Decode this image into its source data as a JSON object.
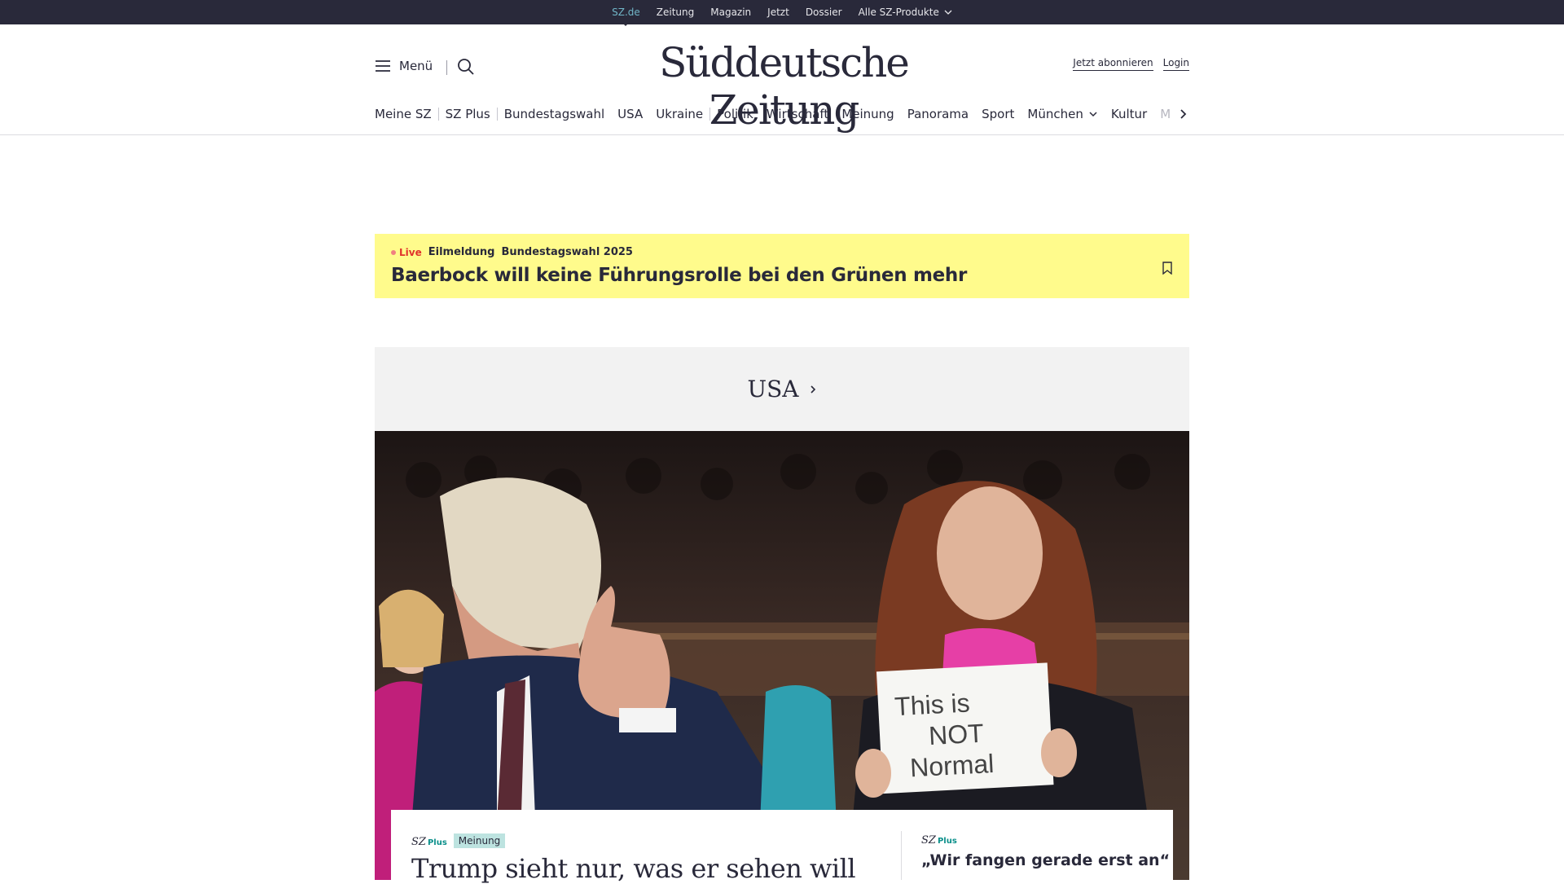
{
  "topbar": {
    "items": [
      "SZ.de",
      "Zeitung",
      "Magazin",
      "Jetzt",
      "Dossier",
      "Alle SZ-Produkte"
    ]
  },
  "header": {
    "menu_label": "Menü",
    "logo": "Süddeutsche Zeitung",
    "subscribe": "Jetzt abonnieren",
    "login": "Login"
  },
  "nav": {
    "items": [
      "Meine SZ",
      "SZ Plus",
      "Bundestagswahl",
      "USA",
      "Ukraine",
      "Politik",
      "Wirtschaft",
      "Meinung",
      "Panorama",
      "Sport",
      "München",
      "Kultur",
      "M"
    ]
  },
  "live": {
    "live_label": "Live",
    "category": "Eilmeldung",
    "topic": "Bundestagswahl 2025",
    "headline": "Baerbock will keine Führungsrolle bei den Grünen mehr"
  },
  "section": {
    "title": "USA"
  },
  "hero": {
    "sign_text": [
      "This is",
      "NOT",
      "Normal"
    ]
  },
  "card": {
    "main": {
      "brand": "SZ",
      "plus": "Plus",
      "tag": "Meinung",
      "title": "Trump sieht nur, was er sehen will"
    },
    "side": {
      "brand": "SZ",
      "plus": "Plus",
      "title": "„Wir fangen gerade erst an“"
    }
  },
  "colors": {
    "dark": "#29293a",
    "live_bg": "#fffb8c",
    "accent_teal": "#71b6c8",
    "live_red": "#e0322c",
    "section_bg": "#f2f2f2"
  }
}
